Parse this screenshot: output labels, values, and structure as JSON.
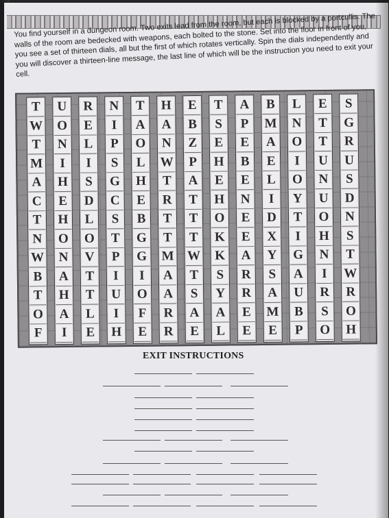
{
  "intro": {
    "text": "You find yourself in a dungeon room. Two exits lead from the room, but each is blocked by a portcullis. The walls of the room are bedecked with weapons, each bolted to the stone. Set into the floor in front of you, you see a set of thirteen dials, all but the first of which rotates vertically. Spin the dials independently and you will discover a thirteen-line message, the last line of which will be the instruction you need to exit your cell."
  },
  "puzzle": {
    "columns": [
      [
        "T",
        "W",
        "T",
        "M",
        "A",
        "C",
        "T",
        "N",
        "W",
        "B",
        "T",
        "O",
        "F"
      ],
      [
        "U",
        "O",
        "N",
        "I",
        "H",
        "E",
        "H",
        "O",
        "N",
        "A",
        "H",
        "A",
        "I"
      ],
      [
        "R",
        "E",
        "L",
        "I",
        "S",
        "D",
        "L",
        "O",
        "V",
        "T",
        "T",
        "L",
        "E"
      ],
      [
        "N",
        "I",
        "P",
        "S",
        "G",
        "C",
        "S",
        "T",
        "P",
        "I",
        "U",
        "I",
        "H"
      ],
      [
        "T",
        "A",
        "O",
        "L",
        "H",
        "E",
        "B",
        "G",
        "G",
        "I",
        "O",
        "F",
        "E"
      ],
      [
        "H",
        "A",
        "N",
        "W",
        "T",
        "R",
        "T",
        "T",
        "M",
        "A",
        "A",
        "R",
        "R"
      ],
      [
        "E",
        "B",
        "Z",
        "P",
        "A",
        "T",
        "T",
        "T",
        "W",
        "T",
        "S",
        "A",
        "E"
      ],
      [
        "T",
        "S",
        "E",
        "H",
        "E",
        "H",
        "O",
        "K",
        "K",
        "S",
        "Y",
        "A",
        "L"
      ],
      [
        "A",
        "P",
        "E",
        "B",
        "E",
        "N",
        "E",
        "E",
        "A",
        "R",
        "R",
        "E",
        "E"
      ],
      [
        "B",
        "M",
        "A",
        "E",
        "L",
        "I",
        "D",
        "X",
        "Y",
        "S",
        "A",
        "M",
        "E"
      ],
      [
        "L",
        "N",
        "O",
        "I",
        "O",
        "Y",
        "T",
        "I",
        "G",
        "A",
        "U",
        "B",
        "P"
      ],
      [
        "E",
        "T",
        "T",
        "U",
        "N",
        "U",
        "O",
        "H",
        "N",
        "I",
        "R",
        "S",
        "O"
      ],
      [
        "S",
        "G",
        "R",
        "U",
        "S",
        "D",
        "N",
        "S",
        "T",
        "W",
        "R",
        "O",
        "H"
      ]
    ]
  },
  "exit": {
    "title": "EXIT INSTRUCTIONS"
  },
  "colors": {
    "page": "#e9e8ec",
    "stone": "#8f8d90",
    "tile": "#eeedef",
    "letter": "#2e2c2e"
  }
}
